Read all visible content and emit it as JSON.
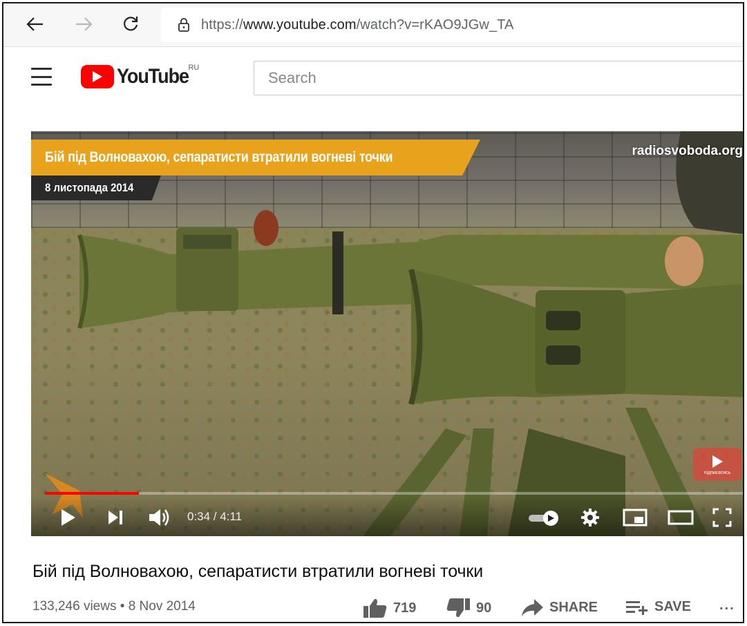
{
  "browser": {
    "url_scheme": "https://",
    "url_host": "www.youtube.com",
    "url_path": "/watch?v=rKAO9JGw_TA"
  },
  "header": {
    "logo_text": "YouTube",
    "region": "RU",
    "search_placeholder": "Search"
  },
  "video": {
    "overlay_title": "Бій під Волновахою, сепаратисти втратили вогневі точки",
    "overlay_date": "8 листопада 2014",
    "watermark": "radiosvoboda.org",
    "subscribe_badge": "підписатись",
    "time_current": "0:34",
    "time_total": "4:11",
    "time_display": "0:34 / 4:11",
    "progress_fraction": 0.135,
    "accent_color": "#ff0000"
  },
  "details": {
    "title": "Бій під Волноваxою, сепаратисти втратили вогневі точки",
    "views": "133,246 views",
    "separator": "•",
    "date": "8 Nov 2014",
    "likes": "719",
    "dislikes": "90",
    "share_label": "SHARE",
    "save_label": "SAVE",
    "more_label": "..."
  },
  "icons": [
    "back-arrow-icon",
    "forward-arrow-icon",
    "reload-icon",
    "lock-icon",
    "menu-icon",
    "youtube-logo-icon",
    "play-icon",
    "next-icon",
    "volume-icon",
    "autoplay-toggle-icon",
    "settings-gear-icon",
    "miniplayer-icon",
    "theater-mode-icon",
    "fullscreen-icon",
    "thumbs-up-icon",
    "thumbs-down-icon",
    "share-icon",
    "save-playlist-icon",
    "more-icon"
  ]
}
